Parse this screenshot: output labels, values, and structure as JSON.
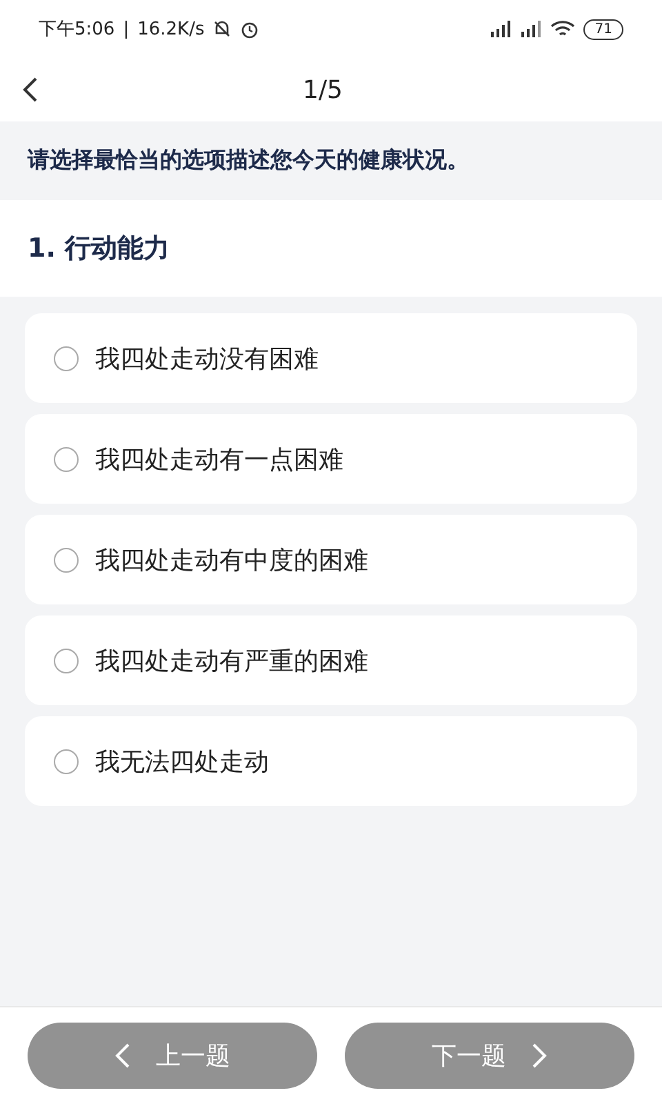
{
  "status_bar": {
    "time": "下午5:06",
    "separator": "|",
    "speed": "16.2K/s",
    "battery": "71"
  },
  "header": {
    "title": "1/5"
  },
  "instruction": "请选择最恰当的选项描述您今天的健康状况。",
  "question": {
    "title": "1. 行动能力",
    "options": [
      {
        "label": "我四处走动没有困难",
        "selected": false
      },
      {
        "label": "我四处走动有一点困难",
        "selected": false
      },
      {
        "label": "我四处走动有中度的困难",
        "selected": false
      },
      {
        "label": "我四处走动有严重的困难",
        "selected": false
      },
      {
        "label": "我无法四处走动",
        "selected": false
      }
    ]
  },
  "footer": {
    "buttons": [
      {
        "kind": "prev",
        "label": "上一题",
        "disabled": true
      },
      {
        "kind": "next",
        "label": "下一题",
        "disabled": true
      }
    ]
  }
}
